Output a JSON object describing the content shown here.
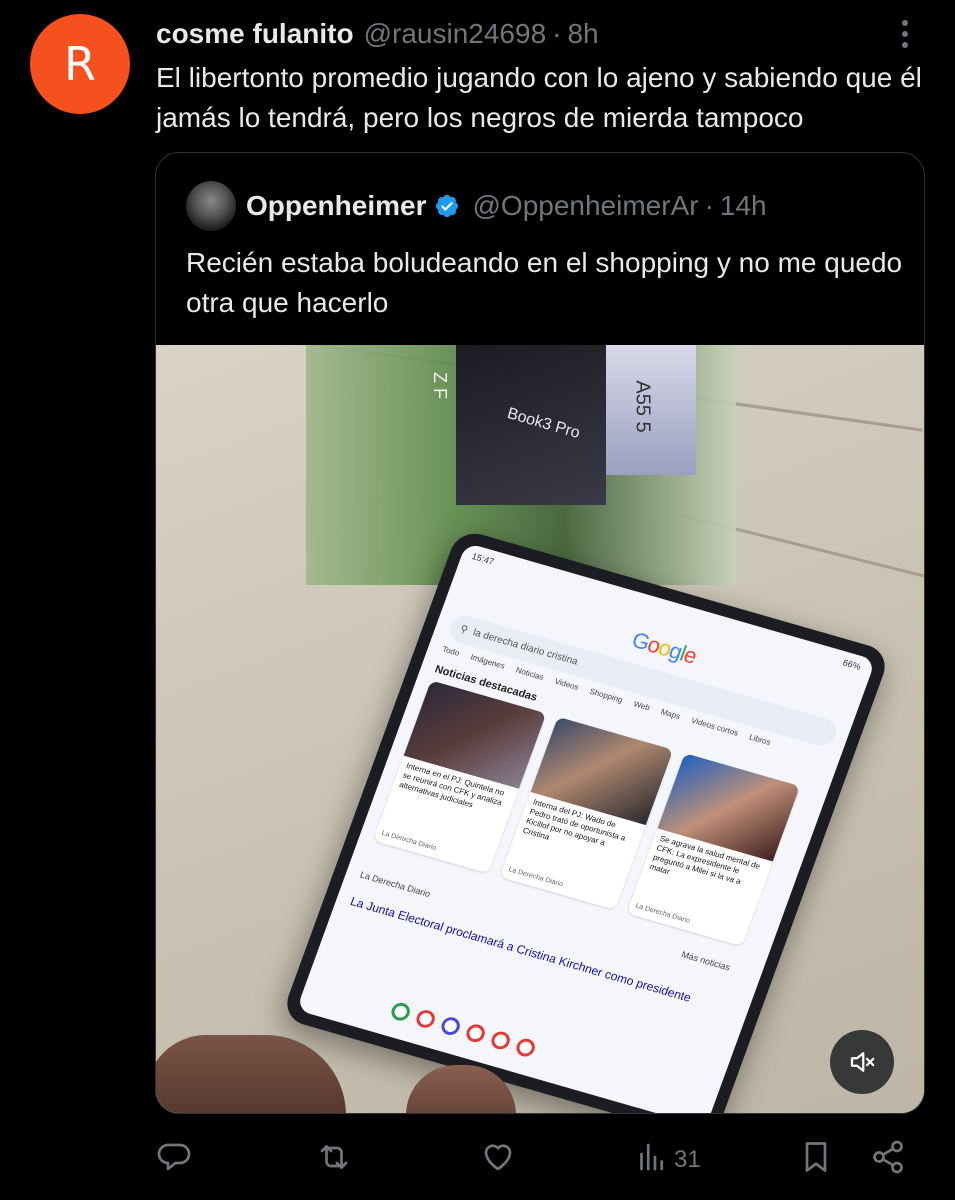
{
  "tweet": {
    "avatar_letter": "R",
    "avatar_color": "#f4511e",
    "display_name": "cosme fulanito",
    "handle": "@rausin24698",
    "separator": "·",
    "time": "8h",
    "text": "El libertonto promedio jugando con lo ajeno y sabiendo que él jamás lo tendrá, pero los negros de mierda tampoco"
  },
  "quoted": {
    "display_name": "Oppenheimer",
    "verified": true,
    "verified_color": "#1d9bf0",
    "handle": "@OppenheimerAr",
    "separator": "·",
    "time": "14h",
    "text": "Recién estaba boludeando en el shopping y no me quedo otra que hacerlo",
    "media": {
      "type": "video",
      "muted": true,
      "box_labels": [
        "Z F",
        "Book3 Pro",
        "A55 5"
      ],
      "phone_screen": {
        "status_time": "15:47",
        "battery": "66%",
        "logo": [
          "G",
          "o",
          "o",
          "g",
          "l",
          "e"
        ],
        "search_query": "la derecha diario cristina",
        "tabs": [
          "Todo",
          "Imágenes",
          "Noticias",
          "Videos",
          "Shopping",
          "Web",
          "Maps",
          "Videos cortos",
          "Libros"
        ],
        "news_heading": "Noticias destacadas",
        "news_cards": [
          {
            "caption": "Interna en el PJ: Quintela no se reunirá con CFK y analiza alternativas judiciales",
            "source": "La Derecha Diario"
          },
          {
            "caption": "Interna del PJ: Wado de Pedro trató de oportunista a Kicillof por no apoyar a Cristina",
            "source": "La Derecha Diario"
          },
          {
            "caption": "Se agrava la salud mental de CFK: La expresidente le preguntó a Milei si la va a matar",
            "source": "La Derecha Diario"
          }
        ],
        "more_news": "Más noticias",
        "result_source": "La Derecha Diario",
        "result_title": "La Junta Electoral proclamará a Cristina Kirchner como presidente"
      }
    }
  },
  "actions": {
    "reply_count": "",
    "retweet_count": "",
    "like_count": "",
    "views_count": "31"
  },
  "icons": {
    "more": "more-vertical-icon",
    "mute": "volume-muted-icon",
    "reply": "reply-icon",
    "retweet": "retweet-icon",
    "like": "heart-icon",
    "views": "views-icon",
    "bookmark": "bookmark-icon",
    "share": "share-icon"
  },
  "colors": {
    "background": "#000000",
    "text": "#e7e9ea",
    "muted": "#71767b",
    "border": "#2f3336"
  }
}
